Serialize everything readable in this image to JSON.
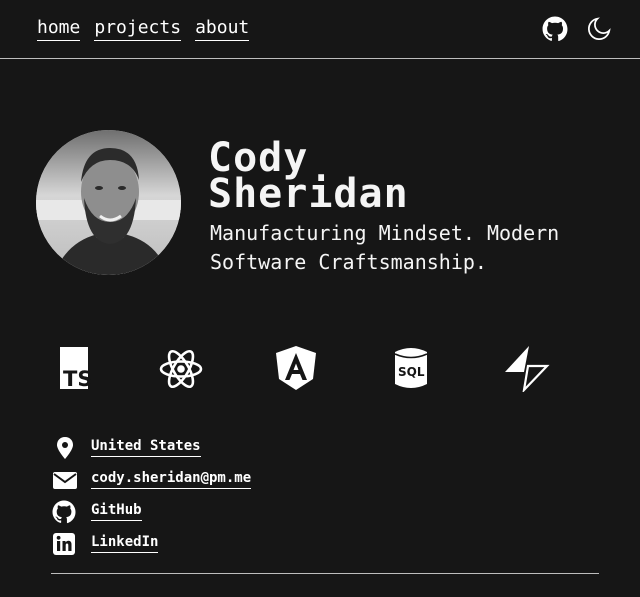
{
  "nav": {
    "items": [
      {
        "label": "home"
      },
      {
        "label": "projects"
      },
      {
        "label": "about"
      }
    ]
  },
  "header_icons": [
    "github-icon",
    "moon-icon"
  ],
  "hero": {
    "name_line1": "Cody",
    "name_line2": "Sheridan",
    "tagline_line1": "Manufacturing Mindset. Modern",
    "tagline_line2": "Software Craftsmanship."
  },
  "tech_icons": [
    {
      "icon": "typescript-icon",
      "text": "TS"
    },
    {
      "icon": "react-icon"
    },
    {
      "icon": "angular-icon"
    },
    {
      "icon": "sql-database-icon",
      "text": "SQL"
    },
    {
      "icon": "supabase-icon"
    }
  ],
  "contacts": [
    {
      "icon": "location-pin-icon",
      "label": "United States"
    },
    {
      "icon": "envelope-icon",
      "label": "cody.sheridan@pm.me"
    },
    {
      "icon": "github-icon",
      "label": "GitHub"
    },
    {
      "icon": "linkedin-icon",
      "label": "LinkedIn"
    }
  ],
  "colors": {
    "background": "#161616",
    "foreground": "#f2f2f2",
    "rule": "#bdbdbd"
  }
}
